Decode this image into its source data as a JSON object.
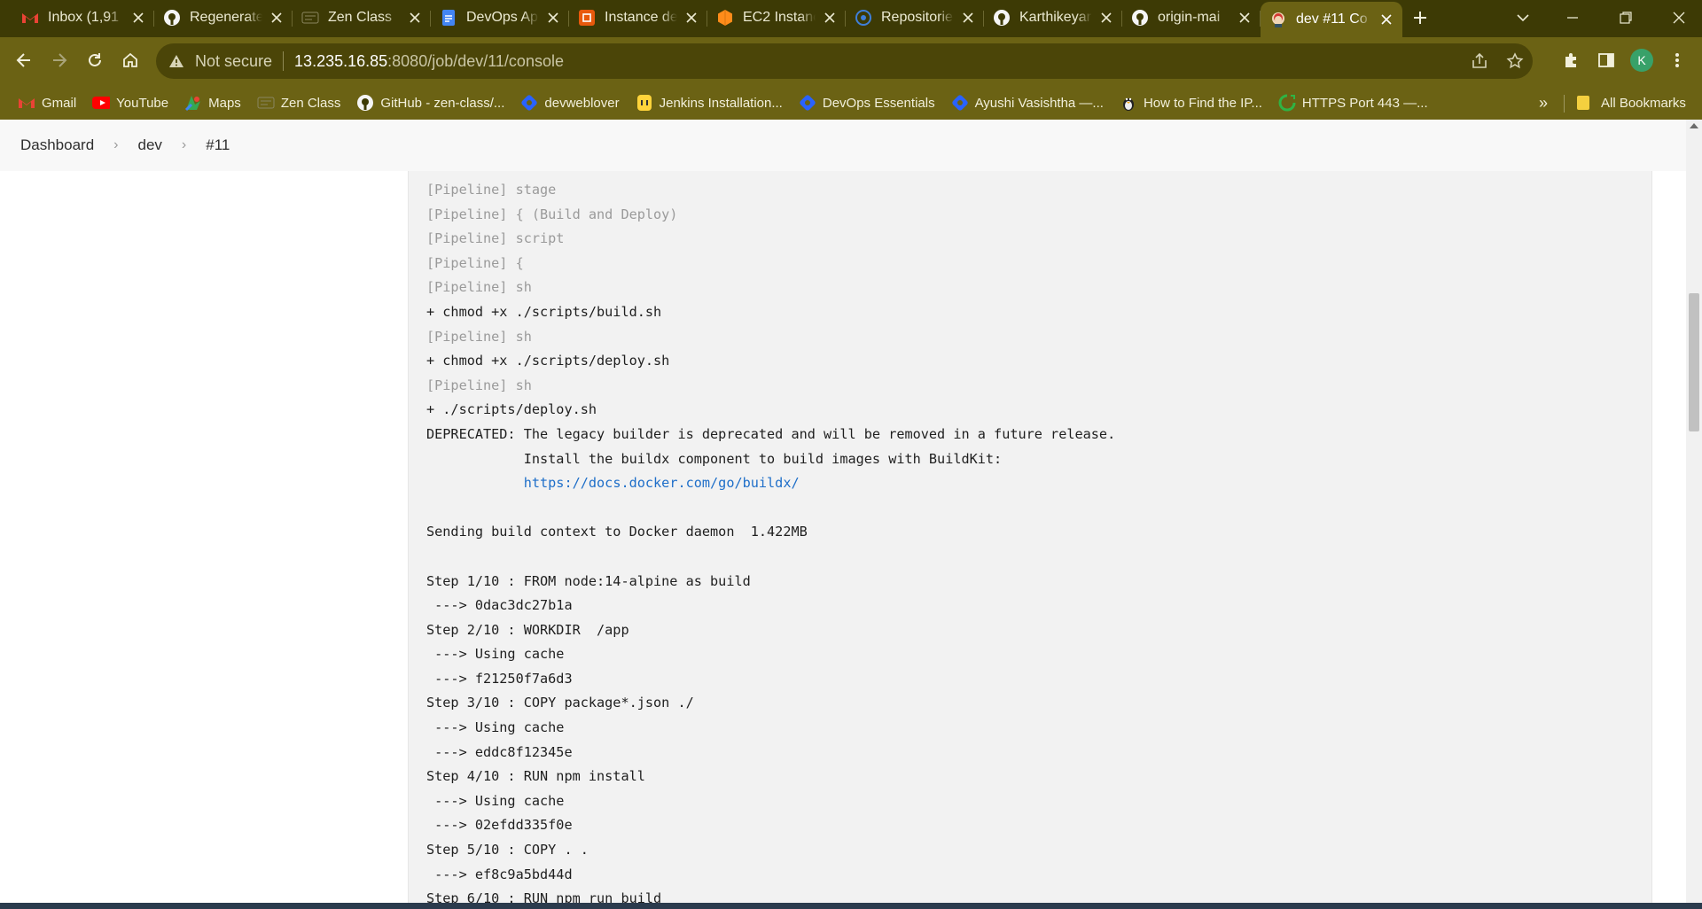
{
  "tabs": [
    {
      "title": "Inbox (1,91",
      "icon": "gmail-icon"
    },
    {
      "title": "Regenerate",
      "icon": "github-icon"
    },
    {
      "title": "Zen Class",
      "icon": "zen-class-icon"
    },
    {
      "title": "DevOps Ap",
      "icon": "google-docs-icon"
    },
    {
      "title": "Instance de",
      "icon": "instance-icon"
    },
    {
      "title": "EC2 Instanc",
      "icon": "aws-icon"
    },
    {
      "title": "Repositorie",
      "icon": "docker-icon"
    },
    {
      "title": "Karthikeyar",
      "icon": "github-icon"
    },
    {
      "title": "origin-mai",
      "icon": "github-icon"
    },
    {
      "title": "dev #11 Co",
      "icon": "jenkins-icon",
      "active": true
    }
  ],
  "address": {
    "security_label": "Not secure",
    "host": "13.235.16.85",
    "path": ":8080/job/dev/11/console"
  },
  "profile_initial": "K",
  "bookmarks": [
    {
      "label": "Gmail",
      "icon": "gmail-icon"
    },
    {
      "label": "YouTube",
      "icon": "youtube-icon"
    },
    {
      "label": "Maps",
      "icon": "maps-icon"
    },
    {
      "label": "Zen Class",
      "icon": "zen-class-icon"
    },
    {
      "label": "GitHub - zen-class/...",
      "icon": "github-icon"
    },
    {
      "label": "devweblover",
      "icon": "hashnode-icon"
    },
    {
      "label": "Jenkins Installation...",
      "icon": "jenkins-installation-icon"
    },
    {
      "label": "DevOps Essentials",
      "icon": "hashnode-icon"
    },
    {
      "label": "Ayushi Vasishtha —...",
      "icon": "hashnode-icon"
    },
    {
      "label": "How to Find the IP...",
      "icon": "linux-icon"
    },
    {
      "label": "HTTPS Port 443 —...",
      "icon": "https-port-icon"
    }
  ],
  "all_bookmarks_label": "All Bookmarks",
  "breadcrumb": {
    "dashboard": "Dashboard",
    "job": "dev",
    "build": "#11"
  },
  "console": {
    "pipeline_lines": [
      "[Pipeline] stage",
      "[Pipeline] { (Build and Deploy)",
      "[Pipeline] script",
      "[Pipeline] {",
      "[Pipeline] sh",
      "+ chmod +x ./scripts/build.sh",
      "[Pipeline] sh",
      "+ chmod +x ./scripts/deploy.sh",
      "[Pipeline] sh",
      "+ ./scripts/deploy.sh",
      "DEPRECATED: The legacy builder is deprecated and will be removed in a future release.",
      "            Install the buildx component to build images with BuildKit:"
    ],
    "link": "https://docs.docker.com/go/buildx/",
    "link_indent": "            ",
    "docker_lines": [
      "",
      "Sending build context to Docker daemon  1.422MB",
      "",
      "Step 1/10 : FROM node:14-alpine as build",
      " ---> 0dac3dc27b1a",
      "Step 2/10 : WORKDIR  /app",
      " ---> Using cache",
      " ---> f21250f7a6d3",
      "Step 3/10 : COPY package*.json ./",
      " ---> Using cache",
      " ---> eddc8f12345e",
      "Step 4/10 : RUN npm install",
      " ---> Using cache",
      " ---> 02efdd335f0e",
      "Step 5/10 : COPY . .",
      " ---> ef8c9a5bd44d",
      "Step 6/10 : RUN npm run build"
    ]
  }
}
